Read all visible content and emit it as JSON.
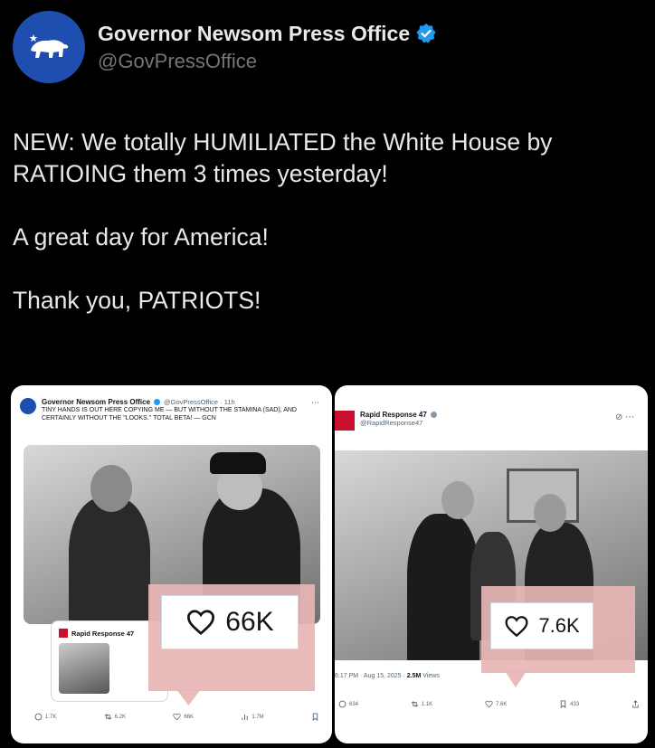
{
  "account": {
    "name": "Governor Newsom Press Office",
    "handle": "@GovPressOffice",
    "verified": true,
    "avatar_icon": "california-bear-icon",
    "avatar_color": "#1d4eb0"
  },
  "tweet": {
    "paragraphs": [
      "NEW: We totally HUMILIATED the White House by RATIOING them 3 times yesterday!",
      "A great day for America!",
      "Thank you, PATRIOTS!"
    ]
  },
  "left_screenshot": {
    "author": "Governor Newsom Press Office",
    "handle_time": "@GovPressOffice · 11h",
    "text": "TINY HANDS IS OUT HERE COPYING ME — BUT WITHOUT THE STAMINA (SAD), AND CERTAINLY WITHOUT THE \"LOOKS.\" TOTAL BETA! — GCN",
    "quoted_author": "Rapid Response 47",
    "like_highlight": "66K",
    "stats": {
      "replies": "1.7K",
      "reposts": "6.2K",
      "likes": "66K",
      "views": "1.7M"
    }
  },
  "right_screenshot": {
    "author": "Rapid Response 47",
    "handle": "@RapidResponse47",
    "like_highlight": "7.6K",
    "timestamp": "6:17 PM · Aug 15, 2025 · ",
    "views": "2.5M",
    "views_label": " Views",
    "stats": {
      "replies": "634",
      "reposts": "1.1K",
      "likes": "7.6K",
      "bookmarks": "433"
    }
  },
  "colors": {
    "accent": "#1d9bf0",
    "highlight": "#e8b5b5",
    "background": "#000000"
  }
}
